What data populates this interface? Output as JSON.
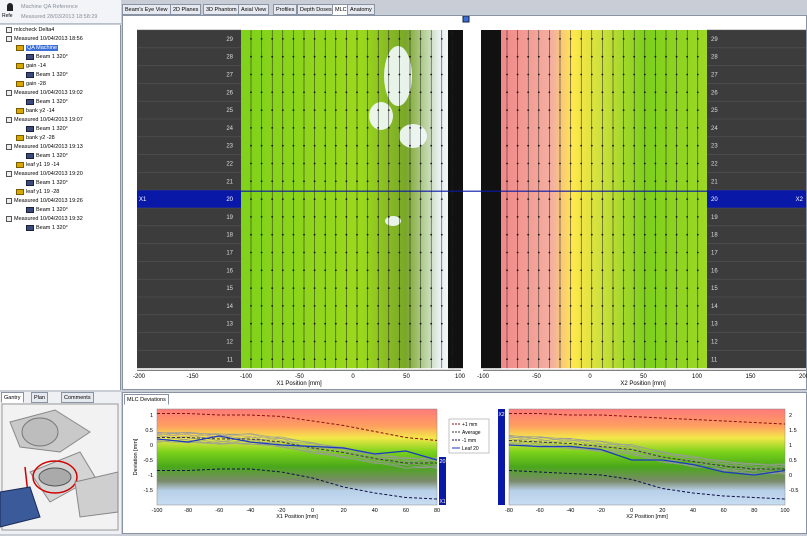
{
  "header": {
    "title": "Machine QA Reference",
    "measured": "Measured 28/03/2013 18:58:29",
    "short": "Refe"
  },
  "tree": [
    {
      "label": "mlccheck Delta4",
      "kind": "patient",
      "indent": 0
    },
    {
      "label": "Measured 10/04/2013 18:56",
      "kind": "measured",
      "indent": 0
    },
    {
      "label": "QA Machine",
      "kind": "plan",
      "indent": 1,
      "selected": true
    },
    {
      "label": "Beam 1  320°",
      "kind": "beam",
      "indent": 2
    },
    {
      "label": "gain -14",
      "kind": "plan",
      "indent": 1
    },
    {
      "label": "Beam 1  320°",
      "kind": "beam",
      "indent": 2
    },
    {
      "label": "gain -28",
      "kind": "plan",
      "indent": 1
    },
    {
      "label": "Measured 10/04/2013 19:02",
      "kind": "measured",
      "indent": 0
    },
    {
      "label": "Beam 1  320°",
      "kind": "beam",
      "indent": 2
    },
    {
      "label": "bank y2 -14",
      "kind": "plan",
      "indent": 1
    },
    {
      "label": "Measured 10/04/2013 19:07",
      "kind": "measured",
      "indent": 0
    },
    {
      "label": "Beam 1  320°",
      "kind": "beam",
      "indent": 2
    },
    {
      "label": "bank y2 -28",
      "kind": "plan",
      "indent": 1
    },
    {
      "label": "Measured 10/04/2013 19:13",
      "kind": "measured",
      "indent": 0
    },
    {
      "label": "Beam 1  320°",
      "kind": "beam",
      "indent": 2
    },
    {
      "label": "leaf y1 19 -14",
      "kind": "plan",
      "indent": 1
    },
    {
      "label": "Measured 10/04/2013 19:20",
      "kind": "measured",
      "indent": 0
    },
    {
      "label": "Beam 1  320°",
      "kind": "beam",
      "indent": 2
    },
    {
      "label": "leaf y1 19 -28",
      "kind": "plan",
      "indent": 1
    },
    {
      "label": "Measured 10/04/2013 19:26",
      "kind": "measured",
      "indent": 0
    },
    {
      "label": "Beam 1  320°",
      "kind": "beam",
      "indent": 2
    },
    {
      "label": "Measured 10/04/2013 19:32",
      "kind": "measured",
      "indent": 0
    },
    {
      "label": "Beam 1  320°",
      "kind": "beam",
      "indent": 2
    }
  ],
  "tabs": [
    "Beam's Eye View",
    "2D Planes",
    "3D Phantom",
    "Axial View",
    "Profiles",
    "Depth Doses",
    "MLC",
    "Anatomy"
  ],
  "active_tab": "MLC",
  "bottom_left_tabs": [
    "Gantry",
    "Plan",
    "Comments"
  ],
  "bottom_tab": "MLC Deviations",
  "mlc_map": {
    "leaf_numbers": [
      "29",
      "28",
      "27",
      "26",
      "25",
      "24",
      "23",
      "22",
      "21",
      "20",
      "19",
      "18",
      "17",
      "16",
      "15",
      "14",
      "13",
      "12",
      "11"
    ],
    "selected_leaf": "20",
    "x1_label": "X1",
    "x2_label": "X2",
    "x1_ticks": [
      "-200",
      "-150",
      "-100",
      "-50",
      "0",
      "50",
      "100"
    ],
    "x2_ticks": [
      "-100",
      "-50",
      "0",
      "50",
      "100",
      "150",
      "200"
    ],
    "x1_axis": "X1 Position [mm]",
    "x2_axis": "X2 Position [mm]"
  },
  "chart_data": [
    {
      "type": "line",
      "xlabel": "X1 Position [mm]",
      "ylabel": "Deviation [mm]",
      "x": [
        -100,
        -80,
        -60,
        -40,
        -20,
        0,
        20,
        40,
        60,
        80
      ],
      "ylim": [
        -2,
        1.2
      ],
      "yticks": [
        "1",
        "0.5",
        "0",
        "-0.5",
        "-1",
        "-1.5"
      ],
      "xticks": [
        "-100",
        "-80",
        "-60",
        "-40",
        "-20",
        "0",
        "20",
        "40",
        "60",
        "80"
      ],
      "series": [
        {
          "name": "+1 mm",
          "values": [
            1.05,
            1.05,
            1.0,
            1.0,
            0.95,
            0.8,
            0.65,
            0.45,
            0.25,
            0.15
          ]
        },
        {
          "name": "Average",
          "values": [
            0.25,
            0.25,
            0.2,
            0.2,
            0.1,
            -0.1,
            -0.25,
            -0.45,
            -0.6,
            -0.6
          ]
        },
        {
          "name": "-1 mm",
          "values": [
            -0.85,
            -0.85,
            -0.8,
            -0.8,
            -0.9,
            -1.1,
            -1.4,
            -1.6,
            -1.75,
            -1.8
          ]
        },
        {
          "name": "Leaf 20",
          "values": [
            0.2,
            0.1,
            0.3,
            0.1,
            0.0,
            -0.05,
            -0.1,
            -0.3,
            -0.2,
            -0.5
          ]
        }
      ],
      "legend": [
        "+1 mm",
        "Average",
        "-1 mm",
        "Leaf 20"
      ],
      "side_label": "20",
      "side_bank": "X1"
    },
    {
      "type": "line",
      "xlabel": "X2 Position [mm]",
      "ylabel": "",
      "x": [
        -80,
        -60,
        -40,
        -20,
        0,
        20,
        40,
        60,
        80,
        100
      ],
      "ylim": [
        -1,
        2.2
      ],
      "yticks": [
        "2",
        "1.5",
        "1",
        "0.5",
        "0",
        "-0.5"
      ],
      "xticks": [
        "-80",
        "-60",
        "-40",
        "-20",
        "0",
        "20",
        "40",
        "60",
        "80",
        "100"
      ],
      "series": [
        {
          "name": "+1 mm",
          "values": [
            2.05,
            2.05,
            2.0,
            2.0,
            1.95,
            1.9,
            1.85,
            1.8,
            1.75,
            1.7
          ]
        },
        {
          "name": "Average",
          "values": [
            1.15,
            1.1,
            1.05,
            0.95,
            0.85,
            0.6,
            0.45,
            0.3,
            0.2,
            0.2
          ]
        },
        {
          "name": "-1 mm",
          "values": [
            0.15,
            0.1,
            0.05,
            0.0,
            -0.15,
            -0.45,
            -0.6,
            -0.7,
            -0.75,
            -0.8
          ]
        },
        {
          "name": "Leaf 20",
          "values": [
            1.0,
            0.95,
            0.95,
            0.85,
            0.5,
            0.5,
            0.35,
            0.1,
            0.0,
            0.15
          ]
        }
      ],
      "side_bank": "X2"
    }
  ]
}
